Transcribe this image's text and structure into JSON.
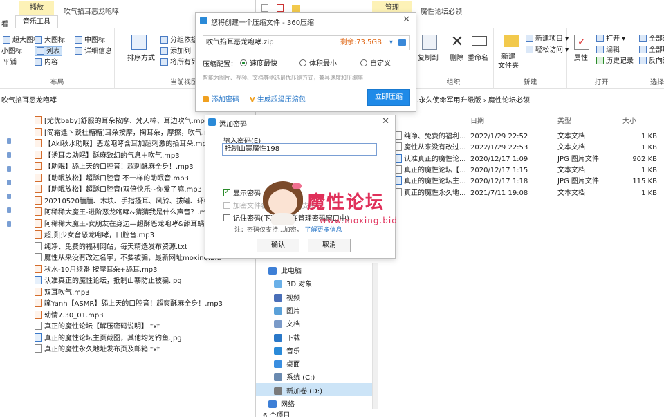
{
  "left_window": {
    "context_tab": "播放",
    "title": "吹气掐耳恶龙咆哮",
    "tabs": [
      "看",
      "音乐工具"
    ],
    "layout": {
      "items": [
        "超大图标",
        "大图标",
        "中图标",
        "小图标",
        "列表",
        "详细信息",
        "平铺",
        "内容"
      ],
      "label": "布局"
    },
    "sort_label": "排序方式",
    "current_view": {
      "items": [
        "分组依据",
        "添加列",
        "将所有列调整为合适的大小"
      ],
      "label": "当前视图"
    },
    "address": "吹气掐耳恶龙咆哮",
    "files": [
      {
        "name": "[尤优baby]舒服的耳朵按摩、梵天棒、耳边吹气.mp3",
        "type": "mp3"
      },
      {
        "name": "[简霜逢丶谈社糖糖]耳朵按摩，掏耳朵，摩擦，吹气.mp3",
        "type": "mp3"
      },
      {
        "name": "【Aki秋水助眠】恶龙咆哮含耳加超刺激的掐耳朵.mp3",
        "type": "mp3"
      },
      {
        "name": "【诱耳の助眠】酥麻致幻的气息＋吹气.mp3",
        "type": "mp3"
      },
      {
        "name": "【助眠】舔上天的口腔音！超刺酥麻全身！.mp3",
        "type": "mp3"
      },
      {
        "name": "【助眠放松】超酥口腔音 不一样的助眠音.mp3",
        "type": "mp3"
      },
      {
        "name": "【助眠放松】超酥口腔音(双倍快乐~你爱了嘛.mp3",
        "type": "mp3"
      },
      {
        "name": "20210520腼腼、木块、手指搔耳、风铃、拔罐、环绕音.mp3",
        "type": "mp3"
      },
      {
        "name": "阿稀稀大魔王-进阶恶龙咆哮&猜猜我是什么声音？.mp3",
        "type": "mp3"
      },
      {
        "name": "阿稀稀大魔王-女朋友在身边—超酥恶龙咆哮&舔耳蜗.mp3",
        "type": "mp3"
      },
      {
        "name": "超顶|少女音恶龙咆哮，口腔音.mp3",
        "type": "mp3"
      },
      {
        "name": "纯净、免费的福利网站，每天精选发布资源.txt",
        "type": "txt"
      },
      {
        "name": "魔性从来没有改过名字，不要被骗，最新网址moxing.bid",
        "type": "txt"
      },
      {
        "name": "秋水-10月续番 按摩耳朵+舔耳.mp3",
        "type": "mp3"
      },
      {
        "name": "认准真正的魔性论坛，抵制山寨防止被骗.jpg",
        "type": "jpg"
      },
      {
        "name": "双耳吹气.mp3",
        "type": "mp3"
      },
      {
        "name": "瞳Yanh【ASMR】舔上天的口腔音！超爽酥麻全身！.mp3",
        "type": "mp3"
      },
      {
        "name": "幼情7.30_01.mp3",
        "type": "mp3"
      },
      {
        "name": "真正的魔性论坛【解压密码说明】.txt",
        "type": "txt"
      },
      {
        "name": "真正的魔性论坛主页截图，其他均为钓鱼.jpg",
        "type": "jpg"
      },
      {
        "name": "真正的魔性永久地址发布页及邮箱.txt",
        "type": "txt"
      }
    ]
  },
  "right_window": {
    "context_tab": "管理",
    "title": "魔性论坛必领",
    "ribbon": {
      "organize": {
        "items": [
          "复制到",
          "删除",
          "重命名"
        ],
        "label": "组织"
      },
      "new": {
        "new_folder": "新建\n文件夹",
        "new_item": "新建项目",
        "easy_access": "轻松访问",
        "label": "新建"
      },
      "open": {
        "properties": "属性",
        "open": "打开",
        "edit": "编辑",
        "history": "历史记录",
        "label": "打开"
      },
      "select": {
        "items": [
          "全部选择",
          "全部取消",
          "反向选择"
        ],
        "label": "选择"
      }
    },
    "address": [
      "...永久使命军用升级版",
      "魔性论坛必领"
    ],
    "columns": [
      "日期",
      "类型",
      "大小"
    ],
    "files": [
      {
        "name": "纯净、免费的福利...",
        "date": "2022/1/29 22:52",
        "type": "文本文档",
        "size": "1 KB",
        "icon": "txt"
      },
      {
        "name": "魔性从来没有改过...",
        "date": "2022/1/29 22:53",
        "type": "文本文档",
        "size": "1 KB",
        "icon": "txt"
      },
      {
        "name": "认准真正的魔性论...",
        "date": "2020/12/17 1:09",
        "type": "JPG 图片文件",
        "size": "902 KB",
        "icon": "jpg"
      },
      {
        "name": "真正的魔性论坛【...",
        "date": "2020/12/17 1:15",
        "type": "文本文档",
        "size": "1 KB",
        "icon": "txt"
      },
      {
        "name": "真正的魔性论坛主...",
        "date": "2020/12/17 1:18",
        "type": "JPG 图片文件",
        "size": "115 KB",
        "icon": "jpg"
      },
      {
        "name": "真正的魔性永久地...",
        "date": "2021/7/11 19:08",
        "type": "文本文档",
        "size": "1 KB",
        "icon": "txt"
      }
    ],
    "nav": [
      {
        "label": "此电脑",
        "color": "#3d7fd6"
      },
      {
        "label": "3D 对象",
        "color": "#6ab0e8"
      },
      {
        "label": "视频",
        "color": "#4a6fb8"
      },
      {
        "label": "图片",
        "color": "#5aa0d8"
      },
      {
        "label": "文档",
        "color": "#7a9ac8"
      },
      {
        "label": "下载",
        "color": "#2a78c8"
      },
      {
        "label": "音乐",
        "color": "#2a8ad8"
      },
      {
        "label": "桌面",
        "color": "#3a8ee0"
      },
      {
        "label": "系统 (C:)",
        "color": "#6a8ab0"
      },
      {
        "label": "新加卷 (D:)",
        "color": "#7a7a7a"
      },
      {
        "label": "网络",
        "color": "#3d7fd6"
      }
    ],
    "status": "6 个项目"
  },
  "zip_dialog": {
    "title": "您将创建一个压缩文件 - 360压缩",
    "filename": "吹气掐耳恶龙咆哮.zip",
    "free_space": "剩余:73.5GB",
    "config_label": "压缩配置：",
    "options": [
      "速度最快",
      "体积最小",
      "自定义"
    ],
    "hint": "智能为图片、视频、文档等挑选最优压缩方式，兼具速度和压缩率",
    "add_password": "添加密码",
    "create_volume": "生成超级压缩包",
    "compress_button": "立即压缩"
  },
  "pwd_dialog": {
    "title": "添加密码",
    "input_label": "输入密码(E)",
    "password_value": "抵制山寨魔性198",
    "show_password": "显示密码",
    "encrypt_names": "加密文件名(ZIP格式不支持)",
    "remember": "记住密码(下次显示在管理密码窗口中)",
    "note": "注：密码仅支持...加密，",
    "learn_more": "了解更多信息",
    "ok": "确认",
    "cancel": "取消"
  },
  "watermark": {
    "text": "魔性论坛",
    "url": "www.moxing.bid",
    "colors": {
      "accent": "#e0305a"
    }
  }
}
